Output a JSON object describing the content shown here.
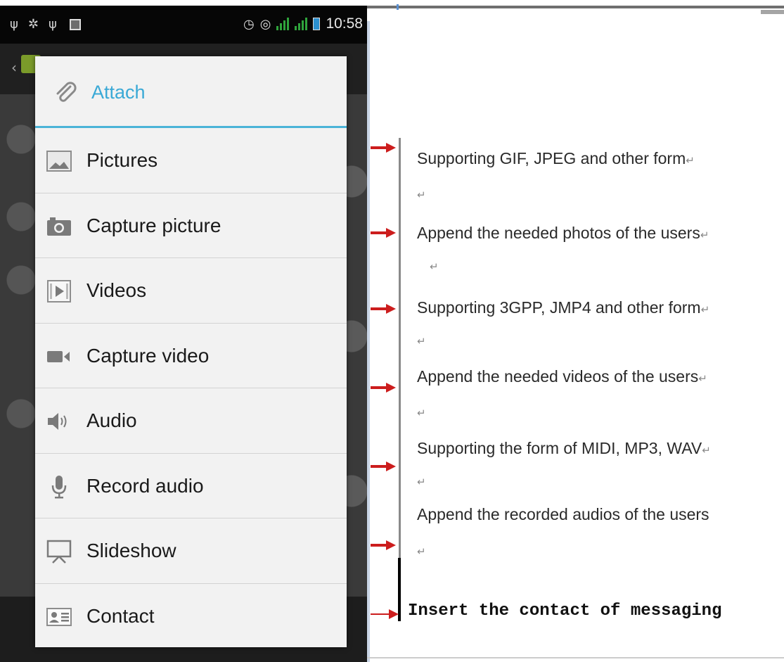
{
  "status_bar": {
    "time": "10:58",
    "left_icons": [
      "usb-icon",
      "android-debug-icon",
      "usb-icon",
      "picture-notification-icon"
    ],
    "right_icons": [
      "alarm-icon",
      "sync-icon",
      "signal-icon",
      "signal-icon",
      "battery-icon"
    ]
  },
  "dialog": {
    "title": "Attach",
    "title_icon": "paperclip-icon",
    "accent_color": "#3aa9d6",
    "items": [
      {
        "label": "Pictures",
        "icon": "picture-icon"
      },
      {
        "label": "Capture picture",
        "icon": "camera-icon"
      },
      {
        "label": "Videos",
        "icon": "video-file-icon"
      },
      {
        "label": "Capture video",
        "icon": "video-camera-icon"
      },
      {
        "label": "Audio",
        "icon": "speaker-icon"
      },
      {
        "label": "Record audio",
        "icon": "microphone-icon"
      },
      {
        "label": "Slideshow",
        "icon": "slideshow-icon"
      },
      {
        "label": "Contact",
        "icon": "contact-card-icon"
      }
    ]
  },
  "annotations": {
    "arrow_color": "#cc1d1d",
    "return_mark": "↵",
    "items": [
      "Supporting GIF, JPEG and other form",
      "Append the needed photos of the users",
      "Supporting 3GPP, JMP4 and other form",
      "Append the needed videos of the users",
      "Supporting the form of MIDI, MP3, WAV",
      "Append the recorded audios of the users"
    ],
    "contact_note": "Insert the contact of messaging"
  }
}
